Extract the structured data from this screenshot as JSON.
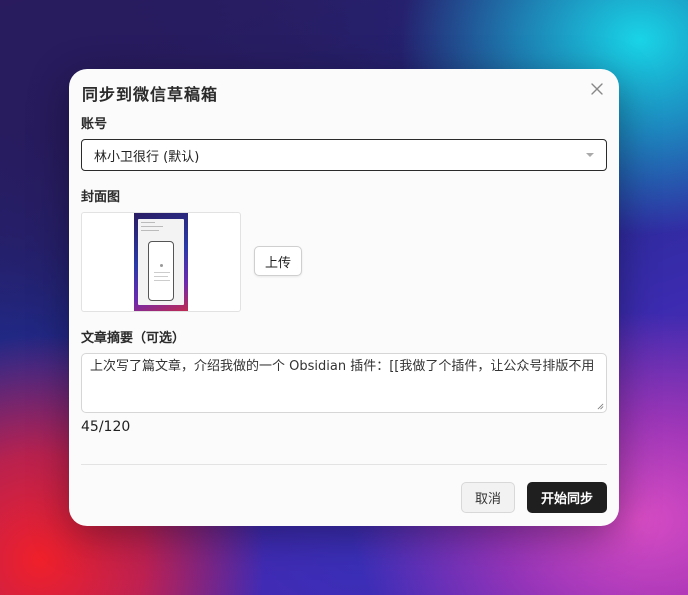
{
  "dialog": {
    "title": "同步到微信草稿箱"
  },
  "account": {
    "label": "账号",
    "selected": "林小卫很行 (默认)"
  },
  "cover": {
    "label": "封面图",
    "upload_label": "上传"
  },
  "summary": {
    "label": "文章摘要（可选）",
    "value": "上次写了篇文章，介绍我做的一个 Obsidian 插件：[[我做了个插件，让公众号排版不用",
    "counter": "45/120"
  },
  "footer": {
    "cancel_label": "取消",
    "start_label": "开始同步"
  },
  "colors": {
    "primary_button": "#1f1f1f",
    "modal_bg": "#fbfbfb"
  }
}
